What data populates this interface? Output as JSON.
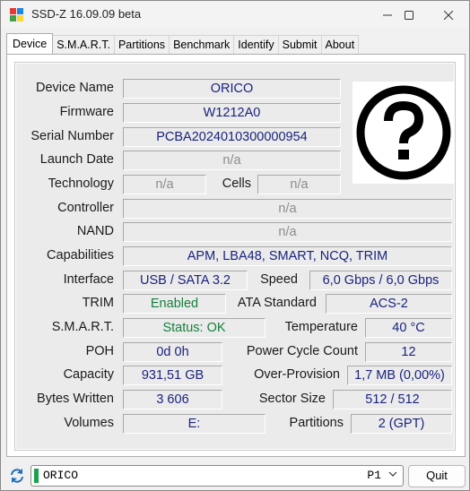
{
  "window": {
    "title": "SSD-Z 16.09.09 beta",
    "minimize_icon": "minimize-icon",
    "maximize_icon": "maximize-icon",
    "close_icon": "close-icon"
  },
  "tabs": [
    {
      "label": "Device",
      "active": true
    },
    {
      "label": "S.M.A.R.T.",
      "active": false
    },
    {
      "label": "Partitions",
      "active": false
    },
    {
      "label": "Benchmark",
      "active": false
    },
    {
      "label": "Identify",
      "active": false
    },
    {
      "label": "Submit",
      "active": false
    },
    {
      "label": "About",
      "active": false
    }
  ],
  "device": {
    "device_name": {
      "label": "Device Name",
      "value": "ORICO"
    },
    "firmware": {
      "label": "Firmware",
      "value": "W1212A0"
    },
    "serial_number": {
      "label": "Serial Number",
      "value": "PCBA2024010300000954"
    },
    "launch_date": {
      "label": "Launch Date",
      "value": "n/a"
    },
    "technology": {
      "label": "Technology",
      "value": "n/a"
    },
    "cells": {
      "label": "Cells",
      "value": "n/a"
    },
    "controller": {
      "label": "Controller",
      "value": "n/a"
    },
    "nand": {
      "label": "NAND",
      "value": "n/a"
    },
    "capabilities": {
      "label": "Capabilities",
      "value": "APM, LBA48, SMART, NCQ, TRIM"
    },
    "interface": {
      "label": "Interface",
      "value": "USB / SATA 3.2"
    },
    "speed": {
      "label": "Speed",
      "value": "6,0 Gbps / 6,0 Gbps"
    },
    "trim": {
      "label": "TRIM",
      "value": "Enabled"
    },
    "ata_standard": {
      "label": "ATA Standard",
      "value": "ACS-2"
    },
    "smart": {
      "label": "S.M.A.R.T.",
      "value": "Status: OK"
    },
    "temperature": {
      "label": "Temperature",
      "value": "40 °C"
    },
    "poh": {
      "label": "POH",
      "value": "0d 0h"
    },
    "power_cycle_count": {
      "label": "Power Cycle Count",
      "value": "12"
    },
    "capacity": {
      "label": "Capacity",
      "value": "931,51 GB"
    },
    "over_provision": {
      "label": "Over-Provision",
      "value": "1,7 MB (0,00%)"
    },
    "bytes_written": {
      "label": "Bytes Written",
      "value": "3 606"
    },
    "sector_size": {
      "label": "Sector Size",
      "value": "512 / 512"
    },
    "volumes": {
      "label": "Volumes",
      "value": "E:"
    },
    "partitions": {
      "label": "Partitions",
      "value": "2 (GPT)"
    },
    "image_icon": "question-mark-icon"
  },
  "colors": {
    "value_text": "#1a237e",
    "na_text": "#8c8c8c",
    "ok_text": "#15803d",
    "drive_accent": "#16a34a"
  },
  "footer": {
    "drive_name": "ORICO",
    "drive_port": "P1",
    "quit_label": "Quit",
    "refresh_icon": "refresh-icon"
  }
}
